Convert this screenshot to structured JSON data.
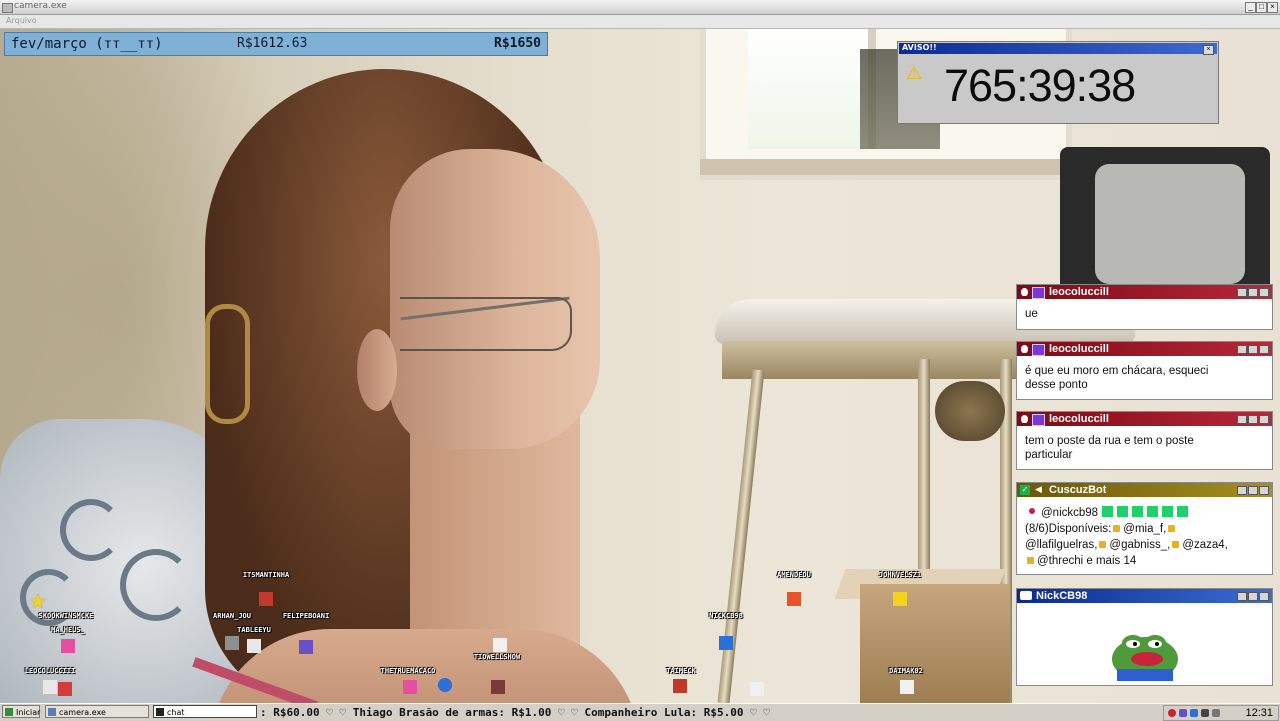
{
  "window": {
    "title": "camera.exe",
    "menu_file": "Arquivo"
  },
  "rent_bar": {
    "month": "fev/março (ᴛᴛ__ᴛᴛ)",
    "current": "R$1612.63",
    "goal": "R$1650",
    "progress": 0.977
  },
  "aviso": {
    "title": "AVISO!!",
    "timer": "765:39:38"
  },
  "chat_popups": [
    {
      "username": "leocoluccill",
      "message": "ue",
      "theme": "red"
    },
    {
      "username": "leocoluccill",
      "message_line1": "é que eu moro em chácara, esqueci",
      "message_line2": "desse ponto",
      "theme": "red"
    },
    {
      "username": "leocoluccill",
      "message_line1": "tem o poste da rua e tem o poste",
      "message_line2": "particular",
      "theme": "red"
    },
    {
      "username": "CuscuzBot",
      "mention": "@nickcb98",
      "line2": "(8/6)Disponíveis:",
      "user_a": "@mia_f,",
      "user_b": "@llafilguelras,",
      "user_c": "@gabniss_,",
      "user_d": "@zaza4,",
      "user_e": "@threchi e mais 14",
      "theme": "gold"
    },
    {
      "username": "NickCB98",
      "emote": "pepe-emote",
      "theme": "blue"
    }
  ],
  "characters": [
    {
      "name": "ITSMANTINHA",
      "color": "#c0392b"
    },
    {
      "name": "SKOOKWINSMCKE",
      "color": "#f4d31e"
    },
    {
      "name": "MA_HEUS_",
      "color": "#e64fa0"
    },
    {
      "name": "ARHAN_JOU",
      "color": "#8e8e8e"
    },
    {
      "name": "TABLEEYU",
      "color": "#e8e8e8"
    },
    {
      "name": "FELIPEBOANI",
      "color": "#6b4fc4"
    },
    {
      "name": "LEOCOLUCCIII",
      "color": "#e8e8e8"
    },
    {
      "name": "THETRUEMACACO",
      "color": "#e64fa0"
    },
    {
      "name": "TIOWELLSHOW",
      "color": "#f0f0f0"
    },
    {
      "name": "AMENDEDU",
      "color": "#e8542a"
    },
    {
      "name": "JOHNVELSZ1",
      "color": "#f4d31e"
    },
    {
      "name": "NICKCB98",
      "color": "#2c6fd6"
    },
    {
      "name": "TAIMECK",
      "color": "#c0392b"
    },
    {
      "name": "DAIMAK02",
      "color": "#f0f0f0"
    }
  ],
  "taskbar": {
    "start": "Iniciar",
    "task_camera": "camera.exe",
    "task_chat": "chat",
    "ticker": ": R$60.00 ♡  ♡ Thiago Brasão de armas: R$1.00 ♡  ♡ Companheiro Lula: R$5.00 ♡  ♡",
    "clock": "12:31"
  },
  "colors": {
    "rent_bar": "#7fb0d6",
    "aviso_title": "#0a2b96",
    "chat_red": "#9c1526",
    "chat_gold": "#8a7412",
    "chat_blue": "#1c46b8"
  }
}
